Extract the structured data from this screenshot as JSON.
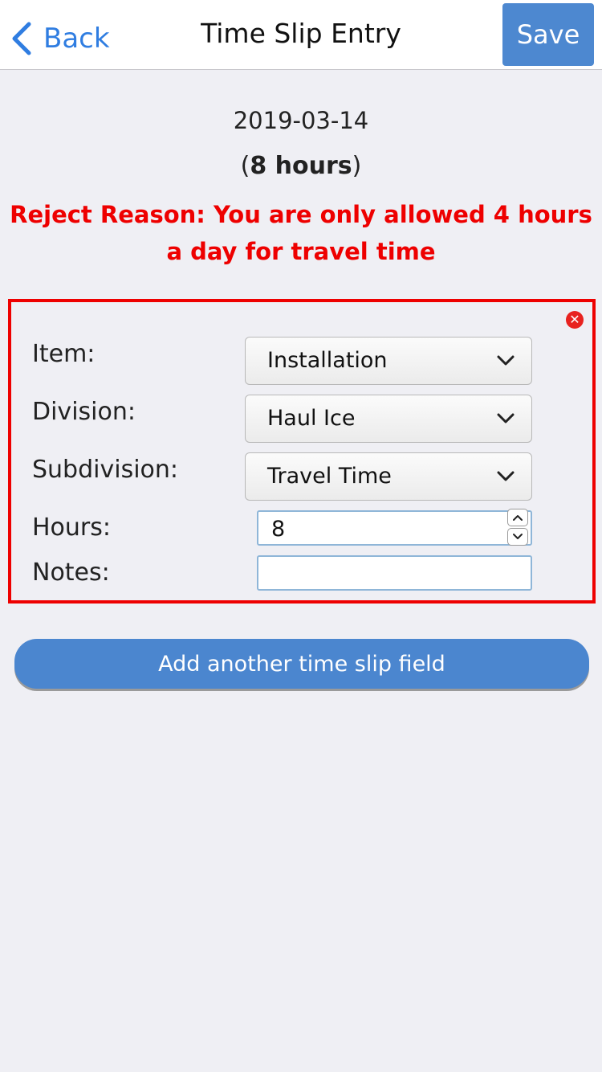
{
  "nav": {
    "back_label": "Back",
    "title": "Time Slip Entry",
    "save_label": "Save"
  },
  "summary": {
    "date": "2019-03-14",
    "hours_open": "(",
    "hours_text": "8 hours",
    "hours_close": ")",
    "reject_reason": "Reject Reason: You are only allowed 4 hours a day for travel time"
  },
  "entry": {
    "remove_glyph": "✕",
    "fields": {
      "item_label": "Item:",
      "item_value": "Installation",
      "division_label": "Division:",
      "division_value": "Haul Ice",
      "subdivision_label": "Subdivision:",
      "subdivision_value": "Travel Time",
      "hours_label": "Hours:",
      "hours_value": "8",
      "notes_label": "Notes:",
      "notes_value": ""
    }
  },
  "add_button_label": "Add another time slip field",
  "colors": {
    "accent": "#4b86cf",
    "link": "#2f7de1",
    "error": "#ee0000",
    "background": "#efeff4"
  },
  "icons": {
    "back": "chevron-left-icon",
    "remove": "close-circle-icon",
    "dropdown": "chevron-down-icon",
    "spin_up": "chevron-up-icon",
    "spin_down": "chevron-down-icon"
  }
}
